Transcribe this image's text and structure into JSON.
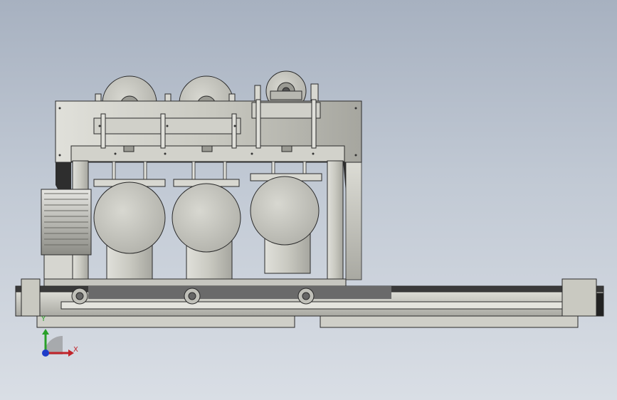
{
  "viewport": {
    "background_top": "#a7b1c0",
    "background_bottom": "#d9dee5"
  },
  "model": {
    "description_icon": "cad-assembly-machine",
    "body_color": "#c9c9c1",
    "body_shade": "#a9a9a2",
    "edge_color": "#2a2a2a",
    "drum_count": 3,
    "pulley_count": 3,
    "roller_count": 3
  },
  "triad": {
    "x_label": "X",
    "y_label": "Y",
    "x_color": "#c0242a",
    "y_color": "#28a028",
    "z_color": "#1e3cc8"
  }
}
